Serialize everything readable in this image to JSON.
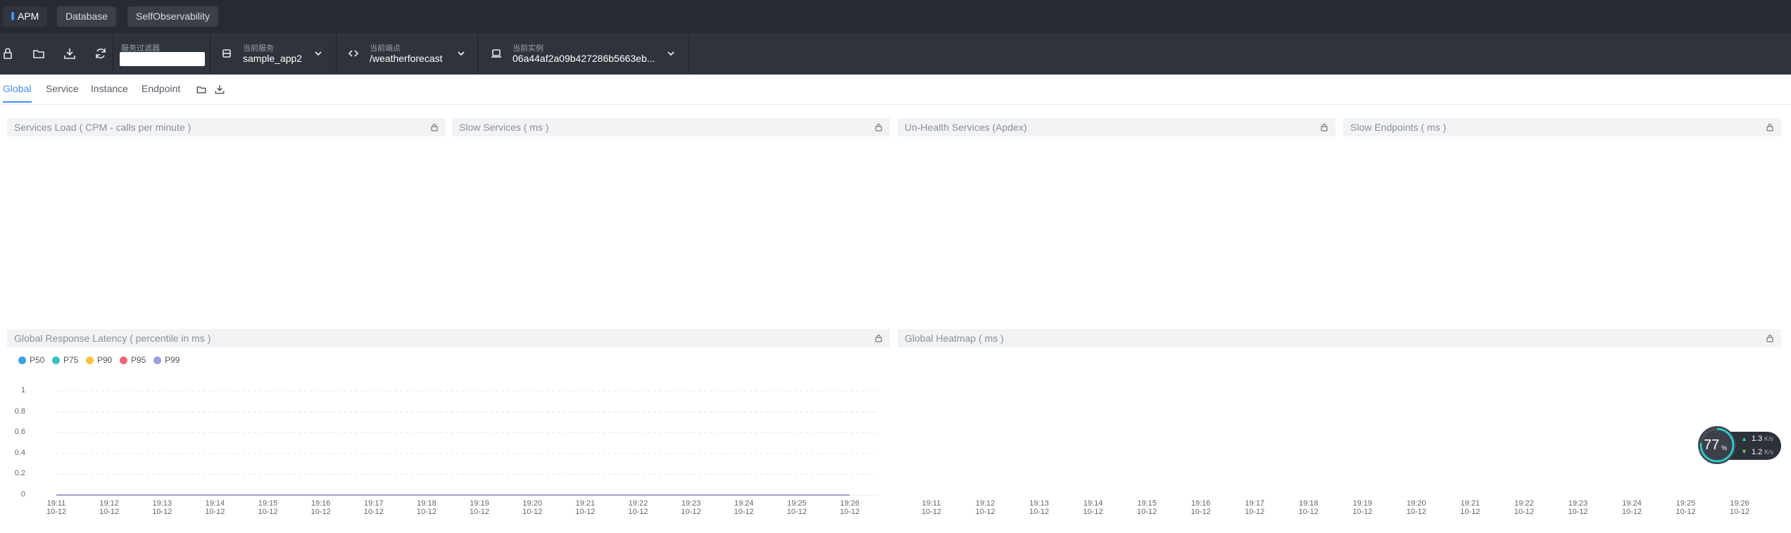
{
  "topnav": {
    "tabs": [
      {
        "label": "APM"
      },
      {
        "label": "Database"
      },
      {
        "label": "SelfObservability"
      }
    ]
  },
  "toolbar": {
    "service_filter_label": "服务过滤器",
    "service_filter_value": "",
    "current_service_label": "当前服务",
    "current_service_value": "sample_app2",
    "current_endpoint_label": "当前端点",
    "current_endpoint_value": "/weatherforecast",
    "current_instance_label": "当前实例",
    "current_instance_value": "06a44af2a09b427286b5663eb..."
  },
  "subtabs": [
    {
      "label": "Global"
    },
    {
      "label": "Service"
    },
    {
      "label": "Instance"
    },
    {
      "label": "Endpoint"
    }
  ],
  "panels": {
    "services_load": "Services Load ( CPM - calls per minute )",
    "slow_services": "Slow Services ( ms )",
    "unhealth_services": "Un-Health Services (Apdex)",
    "slow_endpoints": "Slow Endpoints ( ms )",
    "global_latency": "Global Response Latency ( percentile in ms )",
    "global_heatmap": "Global Heatmap ( ms )"
  },
  "colors": {
    "P50": "#3ba1e5",
    "P75": "#3bbfbf",
    "P90": "#f5c242",
    "P95": "#ee6677",
    "P99": "#9b9ee0"
  },
  "chart_data": [
    {
      "type": "line",
      "title": "Global Response Latency ( percentile in ms )",
      "x": [
        "19:11\n10-12",
        "19:12\n10-12",
        "19:13\n10-12",
        "19:14\n10-12",
        "19:15\n10-12",
        "19:16\n10-12",
        "19:17\n10-12",
        "19:18\n10-12",
        "19:19\n10-12",
        "19:20\n10-12",
        "19:21\n10-12",
        "19:22\n10-12",
        "19:23\n10-12",
        "19:24\n10-12",
        "19:25\n10-12",
        "19:26\n10-12"
      ],
      "series": [
        {
          "name": "P50",
          "values": [
            0,
            0,
            0,
            0,
            0,
            0,
            0,
            0,
            0,
            0,
            0,
            0,
            0,
            0,
            0,
            0
          ]
        },
        {
          "name": "P75",
          "values": [
            0,
            0,
            0,
            0,
            0,
            0,
            0,
            0,
            0,
            0,
            0,
            0,
            0,
            0,
            0,
            0
          ]
        },
        {
          "name": "P90",
          "values": [
            0,
            0,
            0,
            0,
            0,
            0,
            0,
            0,
            0,
            0,
            0,
            0,
            0,
            0,
            0,
            0
          ]
        },
        {
          "name": "P95",
          "values": [
            0,
            0,
            0,
            0,
            0,
            0,
            0,
            0,
            0,
            0,
            0,
            0,
            0,
            0,
            0,
            0
          ]
        },
        {
          "name": "P99",
          "values": [
            0,
            0,
            0,
            0,
            0,
            0,
            0,
            0,
            0,
            0,
            0,
            0,
            0,
            0,
            0,
            0
          ]
        }
      ],
      "yticks": [
        "0",
        "0.2",
        "0.4",
        "0.6",
        "0.8",
        "1"
      ],
      "ylim": [
        0,
        1
      ],
      "legend": "top-left",
      "grid": true
    },
    {
      "type": "heatmap",
      "title": "Global Heatmap ( ms )",
      "x": [
        "19:11\n10-12",
        "19:12\n10-12",
        "19:13\n10-12",
        "19:14\n10-12",
        "19:15\n10-12",
        "19:16\n10-12",
        "19:17\n10-12",
        "19:18\n10-12",
        "19:19\n10-12",
        "19:20\n10-12",
        "19:21\n10-12",
        "19:22\n10-12",
        "19:23\n10-12",
        "19:24\n10-12",
        "19:25\n10-12",
        "19:26\n10-12"
      ],
      "values": []
    }
  ],
  "widget": {
    "percent": "77",
    "percent_unit": "%",
    "upload": "1.3",
    "download": "1.2",
    "rate_unit": "K/s"
  }
}
